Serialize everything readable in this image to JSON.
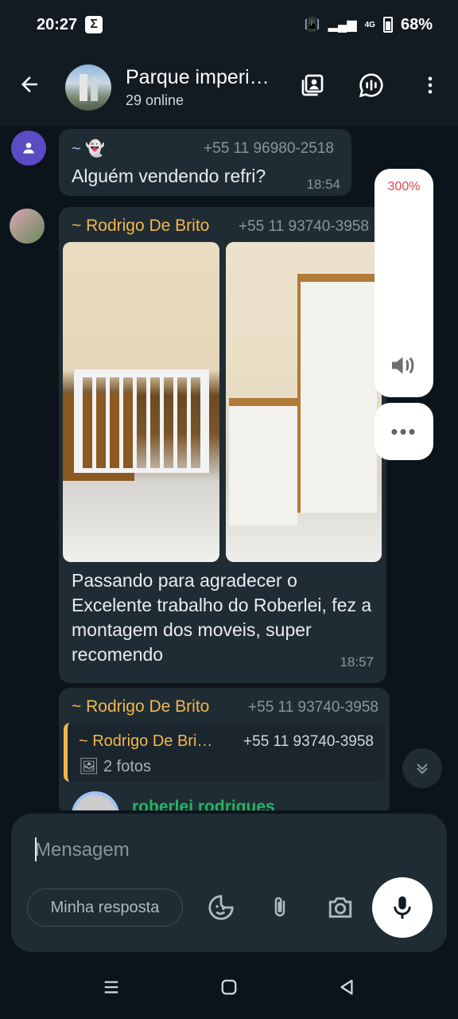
{
  "status_bar": {
    "time": "20:27",
    "network": "4G",
    "battery": "68%"
  },
  "header": {
    "title": "Parque imperi…",
    "subtitle": "29 online"
  },
  "messages": [
    {
      "sender": "~ 👻",
      "phone": "+55 11 96980-2518",
      "text": "Alguém vendendo refri?",
      "time": "18:54"
    },
    {
      "sender": "~ Rodrigo De Brito",
      "phone": "+55 11 93740-3958",
      "text": "Passando para agradecer o Excelente trabalho do Roberlei, fez a montagem dos moveis, super recomendo",
      "time": "18:57"
    },
    {
      "sender": "~ Rodrigo De Brito",
      "phone": "+55 11 93740-3958",
      "quote_sender": "~ Rodrigo De Bri…",
      "quote_phone": "+55 11 93740-3958",
      "quote_body": "2 fotos",
      "forward_name": "roberlei rodrigues"
    }
  ],
  "volume": {
    "label": "300%"
  },
  "composer": {
    "placeholder": "Mensagem",
    "quick_reply": "Minha resposta"
  },
  "icons": {
    "back": "arrow-left-icon",
    "media": "media-gallery-icon",
    "voice_chat": "voice-chat-icon",
    "menu": "more-vert-icon",
    "sticker": "sticker-icon",
    "attach": "paperclip-icon",
    "camera": "camera-icon",
    "mic": "mic-icon"
  }
}
